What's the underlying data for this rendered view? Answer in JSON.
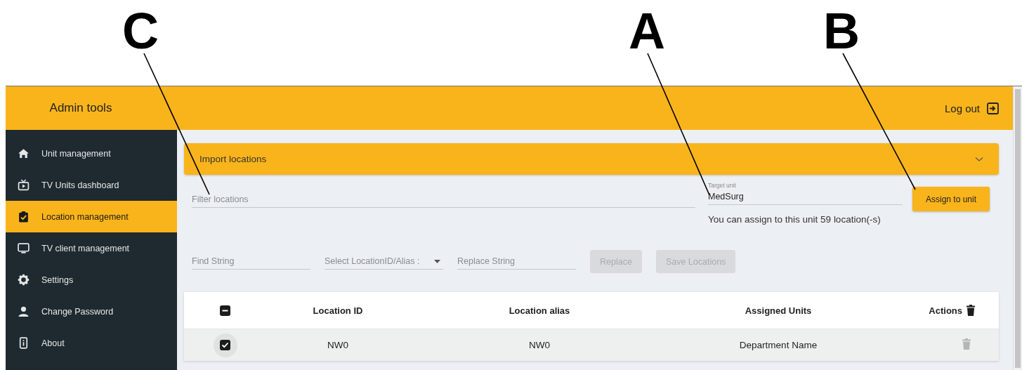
{
  "annotations": [
    {
      "label": "C"
    },
    {
      "label": "A"
    },
    {
      "label": "B"
    }
  ],
  "header": {
    "title": "Admin tools",
    "logout": "Log out"
  },
  "sidebar": {
    "items": [
      {
        "label": "Unit management",
        "selected": false
      },
      {
        "label": "TV Units dashboard",
        "selected": false
      },
      {
        "label": "Location management",
        "selected": true
      },
      {
        "label": "TV client management",
        "selected": false
      },
      {
        "label": "Settings",
        "selected": false
      },
      {
        "label": "Change Password",
        "selected": false
      },
      {
        "label": "About",
        "selected": false
      }
    ]
  },
  "import_panel": {
    "title": "Import locations"
  },
  "filter_field": {
    "placeholder": "Filter locations"
  },
  "target_unit": {
    "label": "Target unit",
    "value": "MedSurg"
  },
  "assign_button": {
    "label": "Assign to unit"
  },
  "assign_message": "You can assign to this unit 59 location(-s)",
  "find_field": {
    "placeholder": "Find String"
  },
  "column_select": {
    "placeholder": "Select LocationID/Alias :"
  },
  "replace_field": {
    "placeholder": "Replace String"
  },
  "action_buttons": [
    {
      "label": "Replace",
      "disabled": true
    },
    {
      "label": "Save Locations",
      "disabled": true
    }
  ],
  "table": {
    "select_all": {
      "indeterminate": true
    },
    "columns": [
      "Location ID",
      "Location alias",
      "Assigned Units",
      "Actions"
    ],
    "rows": [
      {
        "selected": true,
        "location_id": "NW0",
        "location_alias": "NW0",
        "assigned_units": "Department Name"
      }
    ]
  }
}
